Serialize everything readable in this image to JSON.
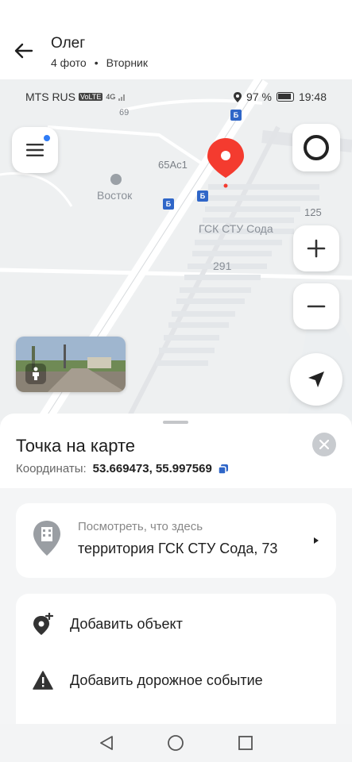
{
  "viewer": {
    "sender": "Олег",
    "photos": "4 фото",
    "separator": "•",
    "day": "Вторник"
  },
  "status_bar": {
    "carrier": "MTS RUS",
    "net_badge": "VoLTE",
    "net_type": "4G",
    "battery": "97 %",
    "time": "19:48"
  },
  "map": {
    "labels": {
      "road_69": "69",
      "house_65": "65Ас1",
      "vostok": "Восток",
      "gsk": "ГСК СТУ Сода",
      "num_125": "125",
      "num_291": "291"
    },
    "bus_stop_glyph": "Б",
    "icons": {
      "menu": "hamburger-menu-icon",
      "assistant": "alice-ring-icon",
      "zoom_in": "plus-icon",
      "zoom_out": "minus-icon",
      "locate": "navigation-arrow-icon",
      "pin": "location-pin-icon"
    },
    "colors": {
      "pin": "#f43b2f",
      "bus_stop": "#2f66c8",
      "menu_dot": "#2f7cf6"
    }
  },
  "sheet": {
    "title": "Точка на карте",
    "coords_label": "Координаты:",
    "coords_value": "53.669473, 55.997569",
    "where_hint": "Посмотреть, что здесь",
    "where_address": "территория ГСК СТУ Сода, 73",
    "actions": [
      {
        "label": "Добавить объект",
        "icon": "add-place-icon"
      },
      {
        "label": "Добавить дорожное событие",
        "icon": "warning-icon"
      }
    ]
  },
  "nav": {
    "back": "back-triangle-icon",
    "home": "home-circle-icon",
    "recents": "recents-square-icon"
  }
}
